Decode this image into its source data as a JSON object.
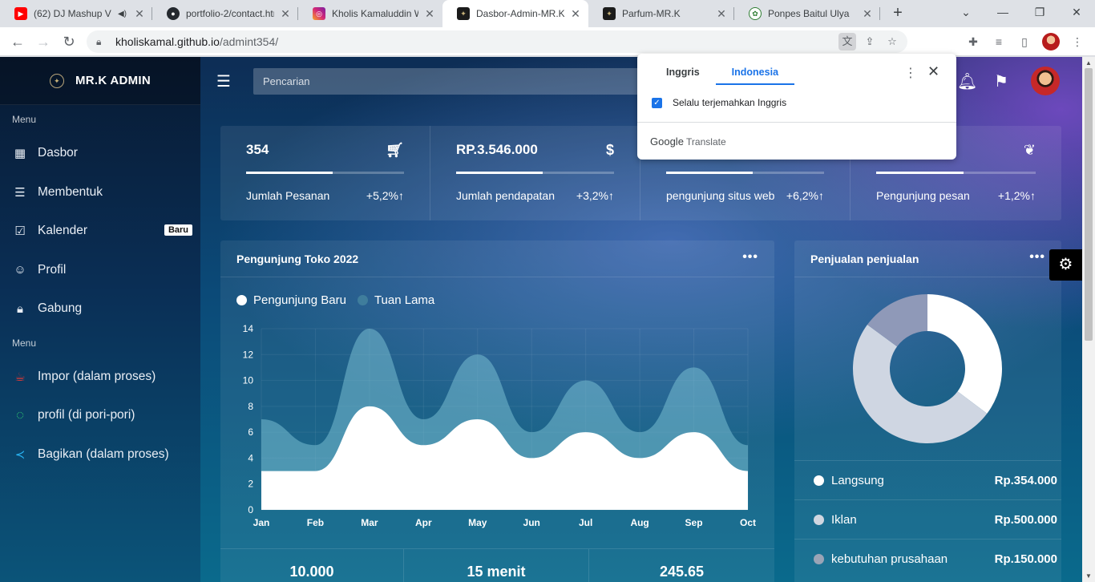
{
  "browser": {
    "tabs": [
      {
        "title": "(62) DJ Mashup V",
        "icon": "youtube-icon",
        "color": "#ff0000"
      },
      {
        "title": "portfolio-2/contact.htm",
        "icon": "github-icon",
        "color": "#24292e"
      },
      {
        "title": "Kholis Kamaluddin Wa",
        "icon": "instagram-icon",
        "color": "#d62976"
      },
      {
        "title": "Dasbor-Admin-MR.K",
        "icon": "site-logo-icon",
        "color": "#1b1b1b"
      },
      {
        "title": "Parfum-MR.K",
        "icon": "site-logo-icon",
        "color": "#1b1b1b"
      },
      {
        "title": "Ponpes Baitul Ulya",
        "icon": "ponpes-logo-icon",
        "color": "#2e7d32"
      }
    ],
    "url_host": "kholiskamal.github.io",
    "url_path": "/admint354/"
  },
  "translate_popup": {
    "tab_source": "Inggris",
    "tab_target": "Indonesia",
    "checkbox_label": "Selalu terjemahkan Inggris",
    "footer_brand": "Google",
    "footer_product": "Translate"
  },
  "sidebar": {
    "brand": "MR.K ADMIN",
    "section1": "Menu",
    "items1": [
      {
        "label": "Dasbor",
        "icon": "dashboard-icon"
      },
      {
        "label": "Membentuk",
        "icon": "list-icon"
      },
      {
        "label": "Kalender",
        "icon": "calendar-icon",
        "badge": "Baru"
      },
      {
        "label": "Profil",
        "icon": "smiley-icon"
      },
      {
        "label": "Gabung",
        "icon": "lock-icon"
      }
    ],
    "section2": "Menu",
    "items2": [
      {
        "label": "Impor (dalam proses)",
        "icon": "coffee-icon",
        "color": "#e53935"
      },
      {
        "label": "profil (di pori-pori)",
        "icon": "circle-notch-icon",
        "color": "#2ecc71"
      },
      {
        "label": "Bagikan (dalam proses)",
        "icon": "share-icon",
        "color": "#29b6f6"
      }
    ]
  },
  "topbar": {
    "search_placeholder": "Pencarian"
  },
  "stats": [
    {
      "value": "354",
      "label": "Jumlah Pesanan",
      "change": "+5,2%↑",
      "progress": 0.55,
      "icon": "cart-icon"
    },
    {
      "value": "RP.3.546.000",
      "label": "Jumlah pendapatan",
      "change": "+3,2%↑",
      "progress": 0.55,
      "icon": "dollar-icon"
    },
    {
      "value": "",
      "label": "pengunjung situs web",
      "change": "+6,2%↑",
      "progress": 0.55,
      "icon": ""
    },
    {
      "value": "",
      "label": "Pengunjung pesan",
      "change": "+1,2%↑",
      "progress": 0.55,
      "icon": "leaf-icon"
    }
  ],
  "visitors_card": {
    "title": "Pengunjung Toko 2022",
    "bottom": [
      "10.000",
      "15 menit",
      "245.65"
    ]
  },
  "sales_card": {
    "title": "Penjualan penjualan",
    "rows": [
      {
        "name": "Langsung",
        "value": "Rp.354.000",
        "color": "#ffffff"
      },
      {
        "name": "Iklan",
        "value": "Rp.500.000",
        "color": "#d0d6e0"
      },
      {
        "name": "kebutuhan prusahaan",
        "value": "Rp.150.000",
        "color": "#9aa4b6"
      }
    ]
  },
  "chart_data": [
    {
      "type": "area",
      "x": [
        "Jan",
        "Feb",
        "Mar",
        "Apr",
        "May",
        "Jun",
        "Jul",
        "Aug",
        "Sep",
        "Oct"
      ],
      "ylim": [
        0,
        14
      ],
      "yticks": [
        0,
        2,
        4,
        6,
        8,
        10,
        12,
        14
      ],
      "series": [
        {
          "name": "Pengunjung Baru",
          "values": [
            3,
            3,
            8,
            5,
            7,
            4,
            6,
            4,
            6,
            3
          ],
          "color": "#ffffff"
        },
        {
          "name": "Tuan Lama",
          "values": [
            7,
            5,
            14,
            7,
            12,
            6,
            10,
            6,
            11,
            5
          ],
          "color": "#6fb3c8"
        }
      ],
      "grid": true
    },
    {
      "type": "pie",
      "donut": true,
      "labels": [
        "Langsung",
        "Iklan",
        "kebutuhan prusahaan"
      ],
      "values": [
        354000,
        500000,
        150000
      ],
      "display_order": [
        0,
        1,
        2
      ],
      "colors": [
        "#ffffff",
        "#d0d6e0",
        "#8f99b8"
      ]
    }
  ]
}
